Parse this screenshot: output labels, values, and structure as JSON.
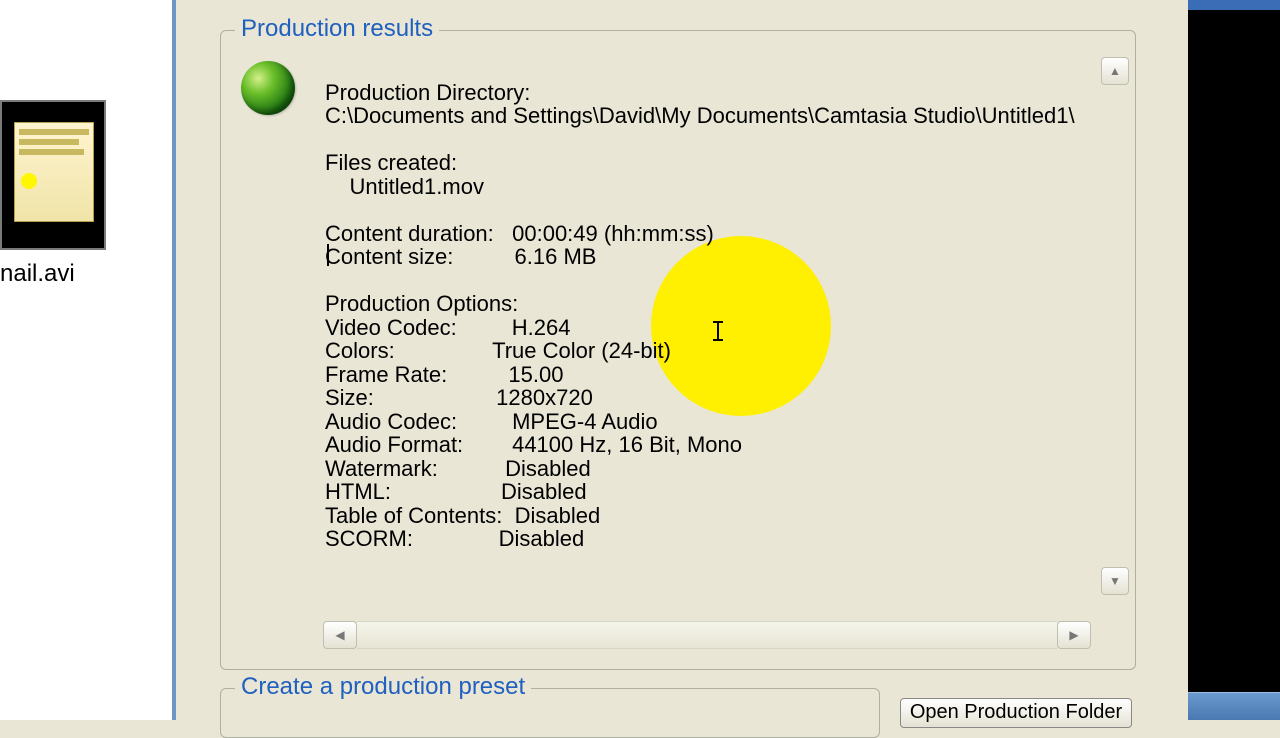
{
  "left": {
    "file_label": "nail.avi"
  },
  "results": {
    "group_title": "Production results",
    "lines": {
      "dir_label": "Production Directory:",
      "dir_value": "C:\\Documents and Settings\\David\\My Documents\\Camtasia Studio\\Untitled1\\",
      "files_created_label": "Files created:",
      "file1": "Untitled1.mov",
      "duration_label": "Content duration:",
      "duration_value": "00:00:49 (hh:mm:ss)",
      "size_label": "Content size:",
      "size_value": "6.16 MB",
      "options_label": "Production Options:",
      "video_codec_label": "Video Codec:",
      "video_codec_value": "H.264",
      "colors_label": "Colors:",
      "colors_value": "True Color (24-bit)",
      "frame_rate_label": "Frame Rate:",
      "frame_rate_value": "15.00",
      "vsize_label": "Size:",
      "vsize_value": "1280x720",
      "audio_codec_label": "Audio Codec:",
      "audio_codec_value": "MPEG-4 Audio",
      "audio_format_label": "Audio Format:",
      "audio_format_value": "44100 Hz, 16 Bit, Mono",
      "watermark_label": "Watermark:",
      "watermark_value": "Disabled",
      "html_label": "HTML:",
      "html_value": "Disabled",
      "toc_label": "Table of Contents:",
      "toc_value": "Disabled",
      "scorm_label": "SCORM:",
      "scorm_value": "Disabled"
    }
  },
  "preset": {
    "group_title": "Create a production preset"
  },
  "buttons": {
    "open_folder": "Open Production Folder"
  },
  "highlight": {
    "color": "#ffef00"
  }
}
